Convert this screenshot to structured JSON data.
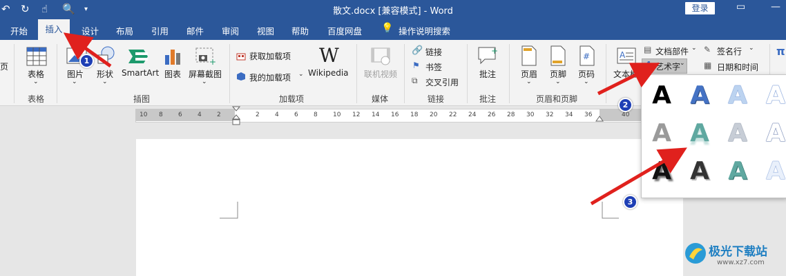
{
  "titlebar": {
    "doc_title": "散文.docx [兼容模式] - Word",
    "login": "登录",
    "qa_icons": [
      "undo-icon",
      "redo-icon",
      "touch-mode-icon",
      "print-preview-icon",
      "customize-icon"
    ]
  },
  "tabs": [
    "开始",
    "插入",
    "设计",
    "布局",
    "引用",
    "邮件",
    "审阅",
    "视图",
    "帮助",
    "百度网盘"
  ],
  "tell_me": "操作说明搜索",
  "ribbon": {
    "tables": {
      "btn": "表格",
      "group": "表格"
    },
    "illustrations": {
      "pictures": "图片",
      "shapes": "形状",
      "smartart": "SmartArt",
      "chart": "图表",
      "screenshot": "屏幕截图",
      "group": "插图"
    },
    "addins": {
      "get": "获取加载项",
      "my": "我的加载项",
      "wikipedia": "Wikipedia",
      "group": "加载项"
    },
    "media": {
      "online_video": "联机视频",
      "group": "媒体"
    },
    "links": {
      "link": "链接",
      "bookmark": "书签",
      "crossref": "交叉引用",
      "group": "链接"
    },
    "comments": {
      "comment": "批注",
      "group": "批注"
    },
    "header_footer": {
      "header": "页眉",
      "footer": "页脚",
      "page_number": "页码",
      "group": "页眉和页脚"
    },
    "text": {
      "textbox": "文本框",
      "quick_parts": "文档部件",
      "wordart": "艺术字",
      "signature": "签名行",
      "datetime": "日期和时间"
    },
    "left_partial": "页",
    "right_partial": "π Ω"
  },
  "ruler_numbers": [
    "10",
    "8",
    "6",
    "4",
    "2",
    "2",
    "4",
    "6",
    "8",
    "10",
    "12",
    "14",
    "16",
    "18",
    "20",
    "22",
    "24",
    "26",
    "28",
    "30",
    "32",
    "34",
    "36",
    "40"
  ],
  "gallery_letter": "A",
  "annotations": [
    "1",
    "2",
    "3"
  ],
  "watermark": {
    "name": "极光下载站",
    "url": "www.xz7.com"
  },
  "colors": {
    "accent": "#2b579a",
    "arrow": "#e0211d",
    "badge": "#1e3fb5"
  }
}
